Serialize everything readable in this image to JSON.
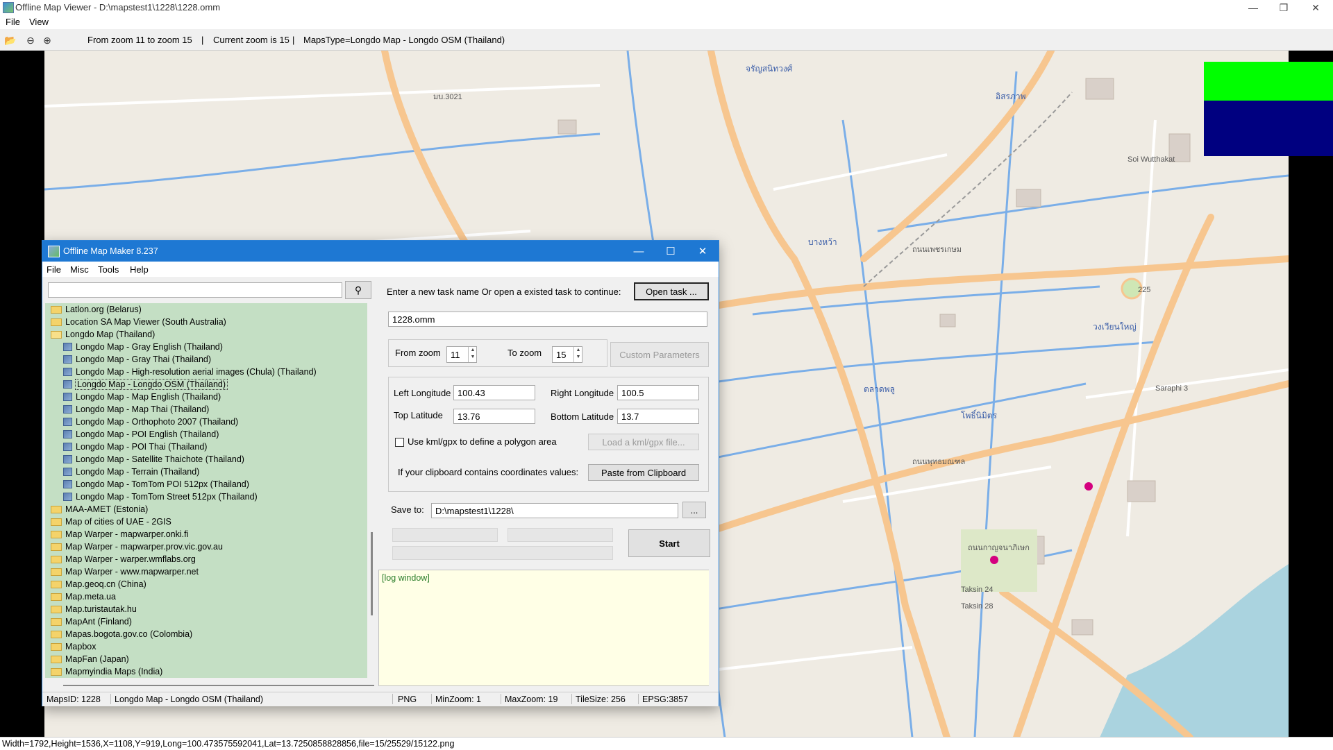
{
  "viewer": {
    "title": "Offline Map Viewer - D:\\mapstest1\\1228\\1228.omm",
    "menu": [
      "File",
      "View"
    ],
    "toolbar": {
      "zoom_range": "From zoom 11 to zoom 15",
      "sep1": "|",
      "current_zoom": "Current zoom is 15",
      "sep2": "|",
      "maps_type": "MapsType=Longdo Map - Longdo OSM (Thailand)"
    },
    "status": "Width=1792,Height=1536,X=1108,Y=919,Long=100.473575592041,Lat=13.7250858828856,file=15/25529/15122.png",
    "swatch_colors": [
      "#00ff00",
      "#000080"
    ]
  },
  "dialog": {
    "title": "Offline Map Maker 8.237",
    "menu": [
      "File",
      "Misc",
      "Tools",
      "Help"
    ],
    "search_value": "",
    "tree": [
      {
        "label": "Latlon.org (Belarus)",
        "type": "folder",
        "level": 0
      },
      {
        "label": "Location SA Map Viewer (South Australia)",
        "type": "folder",
        "level": 0
      },
      {
        "label": "Longdo Map (Thailand)",
        "type": "folder-open",
        "level": 0
      },
      {
        "label": "Longdo Map - Gray English (Thailand)",
        "type": "map",
        "level": 1
      },
      {
        "label": "Longdo Map - Gray Thai (Thailand)",
        "type": "map",
        "level": 1
      },
      {
        "label": "Longdo Map - High-resolution aerial images (Chula) (Thailand)",
        "type": "map",
        "level": 1
      },
      {
        "label": "Longdo Map - Longdo OSM (Thailand)",
        "type": "map",
        "level": 1,
        "selected": true
      },
      {
        "label": "Longdo Map - Map English (Thailand)",
        "type": "map",
        "level": 1
      },
      {
        "label": "Longdo Map - Map Thai (Thailand)",
        "type": "map",
        "level": 1
      },
      {
        "label": "Longdo Map - Orthophoto 2007 (Thailand)",
        "type": "map",
        "level": 1
      },
      {
        "label": "Longdo Map - POI English (Thailand)",
        "type": "map",
        "level": 1
      },
      {
        "label": "Longdo Map - POI Thai (Thailand)",
        "type": "map",
        "level": 1
      },
      {
        "label": "Longdo Map - Satellite Thaichote (Thailand)",
        "type": "map",
        "level": 1
      },
      {
        "label": "Longdo Map - Terrain (Thailand)",
        "type": "map",
        "level": 1
      },
      {
        "label": "Longdo Map - TomTom POI 512px (Thailand)",
        "type": "map",
        "level": 1
      },
      {
        "label": "Longdo Map - TomTom Street 512px (Thailand)",
        "type": "map",
        "level": 1
      },
      {
        "label": "MAA-AMET (Estonia)",
        "type": "folder",
        "level": 0
      },
      {
        "label": "Map of cities of UAE - 2GIS",
        "type": "folder",
        "level": 0
      },
      {
        "label": "Map Warper - mapwarper.onki.fi",
        "type": "folder",
        "level": 0
      },
      {
        "label": "Map Warper - mapwarper.prov.vic.gov.au",
        "type": "folder",
        "level": 0
      },
      {
        "label": "Map Warper - warper.wmflabs.org",
        "type": "folder",
        "level": 0
      },
      {
        "label": "Map Warper - www.mapwarper.net",
        "type": "folder",
        "level": 0
      },
      {
        "label": "Map.geoq.cn (China)",
        "type": "folder",
        "level": 0
      },
      {
        "label": "Map.meta.ua",
        "type": "folder",
        "level": 0
      },
      {
        "label": "Map.turistautak.hu",
        "type": "folder",
        "level": 0
      },
      {
        "label": "MapAnt (Finland)",
        "type": "folder",
        "level": 0
      },
      {
        "label": "Mapas.bogota.gov.co (Colombia)",
        "type": "folder",
        "level": 0
      },
      {
        "label": "Mapbox",
        "type": "folder",
        "level": 0
      },
      {
        "label": "MapFan (Japan)",
        "type": "folder",
        "level": 0
      },
      {
        "label": "Mapmyindia Maps (India)",
        "type": "folder",
        "level": 0
      }
    ],
    "task_prompt": "Enter a new task name Or open a existed task to continue:",
    "open_task_label": "Open task ...",
    "task_name": "1228.omm",
    "from_zoom_label": "From zoom",
    "from_zoom": "11",
    "to_zoom_label": "To zoom",
    "to_zoom": "15",
    "custom_params_label": "Custom Parameters",
    "left_lon_label": "Left Longitude",
    "left_lon": "100.43",
    "right_lon_label": "Right Longitude",
    "right_lon": "100.5",
    "top_lat_label": "Top Latitude",
    "top_lat": "13.76",
    "bottom_lat_label": "Bottom Latitude",
    "bottom_lat": "13.7",
    "kml_label": "Use kml/gpx to define a polygon area",
    "kml_checked": false,
    "load_kml_label": "Load a kml/gpx file...",
    "clipboard_label": "If your clipboard contains coordinates values:",
    "paste_label": "Paste from Clipboard",
    "save_to_label": "Save to:",
    "save_to": "D:\\mapstest1\\1228\\",
    "browse_label": "...",
    "start_label": "Start",
    "log_text": "[log window]",
    "status": {
      "maps_id": "MapsID: 1228",
      "name": "Longdo Map - Longdo OSM (Thailand)",
      "format": "PNG",
      "min_zoom": "MinZoom: 1",
      "max_zoom": "MaxZoom: 19",
      "tile_size": "TileSize: 256",
      "epsg": "EPSG:3857"
    }
  },
  "map_labels": [
    {
      "text": "ถนนเพชรเกษม"
    },
    {
      "text": "ถนนพุทธมณฑล"
    },
    {
      "text": "ถนนกาญจนาภิเษก"
    },
    {
      "text": "ตลาดพลู"
    },
    {
      "text": "วงเวียนใหญ่"
    },
    {
      "text": "โพธิ์นิมิตร"
    },
    {
      "text": "อิสรภาพ"
    },
    {
      "text": "จรัญสนิทวงศ์"
    },
    {
      "text": "บางหว้า"
    },
    {
      "text": "มบ.3021"
    },
    {
      "text": "225"
    },
    {
      "text": "Taksin 24"
    },
    {
      "text": "Taksin 28"
    },
    {
      "text": "Soi Wutthakat"
    },
    {
      "text": "Saraphi 3"
    }
  ]
}
